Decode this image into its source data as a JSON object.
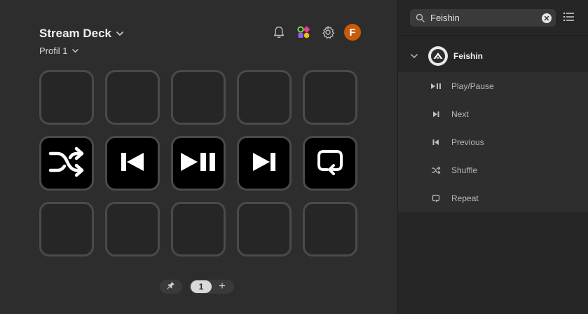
{
  "header": {
    "app_title": "Stream Deck",
    "profile": "Profil 1",
    "avatar_letter": "F",
    "icons": [
      "bell-icon",
      "marketplace-icon",
      "gear-icon"
    ]
  },
  "keys": [
    {
      "icon": null
    },
    {
      "icon": null
    },
    {
      "icon": null
    },
    {
      "icon": null
    },
    {
      "icon": null
    },
    {
      "icon": "shuffle-icon"
    },
    {
      "icon": "previous-icon"
    },
    {
      "icon": "play-pause-icon"
    },
    {
      "icon": "next-icon"
    },
    {
      "icon": "repeat-icon"
    },
    {
      "icon": null
    },
    {
      "icon": null
    },
    {
      "icon": null
    },
    {
      "icon": null
    },
    {
      "icon": null
    }
  ],
  "pager": {
    "current_page": "1",
    "add_label": "+"
  },
  "sidebar": {
    "search": {
      "value": "Feishin"
    },
    "plugin": {
      "name": "Feishin"
    },
    "actions": [
      {
        "label": "Play/Pause",
        "icon": "play-pause-icon"
      },
      {
        "label": "Next",
        "icon": "next-icon"
      },
      {
        "label": "Previous",
        "icon": "previous-icon"
      },
      {
        "label": "Shuffle",
        "icon": "shuffle-icon"
      },
      {
        "label": "Repeat",
        "icon": "repeat-icon"
      }
    ]
  },
  "colors": {
    "background": "#2d2d2d",
    "sidebar": "#262626",
    "avatar": "#c85a0c",
    "key_border": "#4a4a4a"
  }
}
